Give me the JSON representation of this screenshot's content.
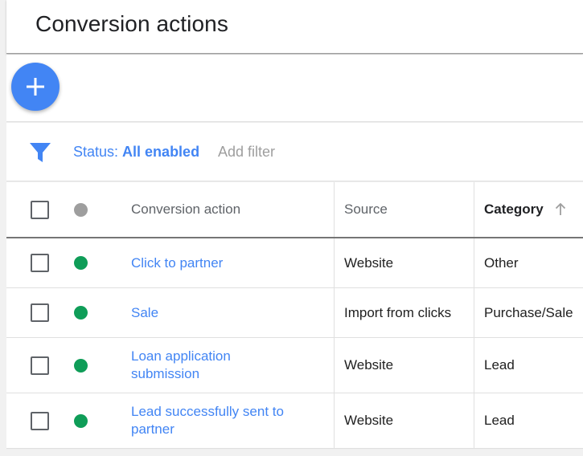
{
  "header": {
    "title": "Conversion actions"
  },
  "fab": {
    "icon": "plus-icon"
  },
  "filter": {
    "icon": "filter-icon",
    "status_label": "Status:",
    "status_value": "All enabled",
    "add_filter_label": "Add filter"
  },
  "table": {
    "columns": {
      "status": "status-dot",
      "conversion_action": "Conversion action",
      "source": "Source",
      "category": "Category",
      "category_sort": "arrow-up-icon"
    },
    "rows": [
      {
        "name": "Click to partner",
        "source": "Website",
        "category": "Other",
        "status": "enabled"
      },
      {
        "name": "Sale",
        "source": "Import from clicks",
        "category": "Purchase/Sale",
        "status": "enabled"
      },
      {
        "name": "Loan application submission",
        "source": "Website",
        "category": "Lead",
        "status": "enabled"
      },
      {
        "name": "Lead successfully sent to partner",
        "source": "Website",
        "category": "Lead",
        "status": "enabled"
      }
    ]
  },
  "colors": {
    "accent": "#4285f4",
    "enabled": "#0f9d58",
    "header_dot": "#9e9e9e"
  }
}
